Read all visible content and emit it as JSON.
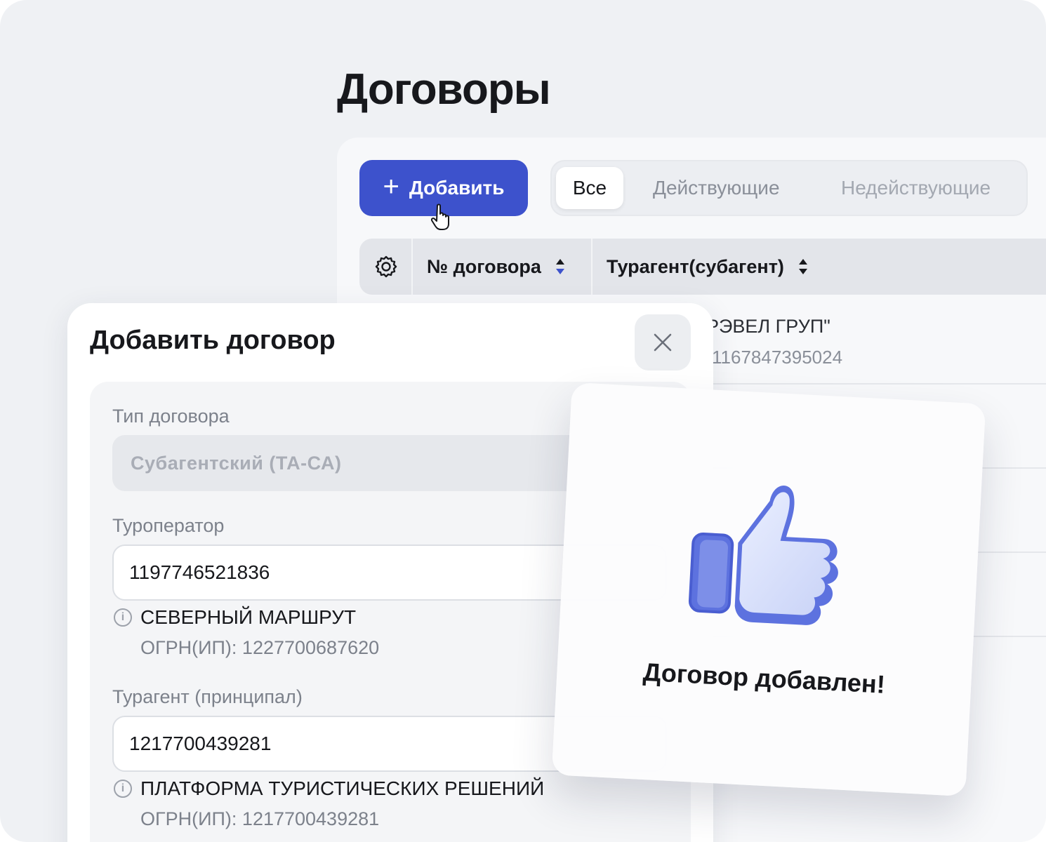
{
  "page": {
    "title": "Договоры"
  },
  "toolbar": {
    "add_label": "Добавить"
  },
  "tabs": [
    {
      "label": "Все",
      "active": true
    },
    {
      "label": "Действующие",
      "active": false
    },
    {
      "label": "Недействующие",
      "active": false
    }
  ],
  "table": {
    "headers": [
      "№ договора",
      "Турагент(субагент)"
    ],
    "rows": [
      {
        "agent": "РЭВЕЛ ГРУП\"",
        "ogrn": "1167847395024"
      }
    ]
  },
  "modal": {
    "title": "Добавить договор",
    "contract_type": {
      "label": "Тип договора",
      "value": "Субагентский (ТА-СА)"
    },
    "operator": {
      "label": "Туроператор",
      "value": "1197746521836",
      "name": "СЕВЕРНЫЙ МАРШРУТ",
      "ogrn": "ОГРН(ИП): 1227700687620"
    },
    "principal": {
      "label": "Турагент (принципал)",
      "value": "1217700439281",
      "name": "ПЛАТФОРМА ТУРИСТИЧЕСКИХ РЕШЕНИЙ",
      "ogrn": "ОГРН(ИП): 1217700439281"
    }
  },
  "toast": {
    "message": "Договор добавлен!"
  },
  "colors": {
    "accent": "#3d52cc",
    "background": "#eff1f4",
    "thumb": "#6a7fe0"
  }
}
